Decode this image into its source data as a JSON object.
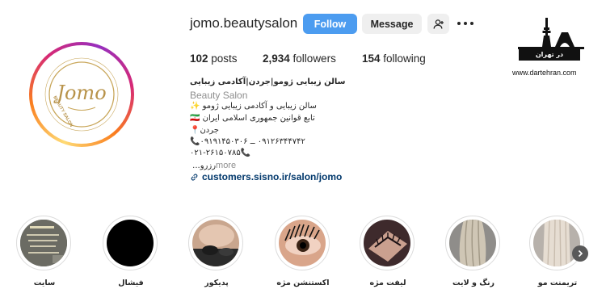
{
  "profile": {
    "username": "jomo.beautysalon",
    "avatar_logo_text": "Jomo",
    "avatar_sub_text": "BEAUTY SALON"
  },
  "actions": {
    "follow_label": "Follow",
    "message_label": "Message",
    "suggest_icon": "add-person-icon",
    "more_icon": "more-options-icon"
  },
  "stats": {
    "posts_count": "102",
    "posts_label": " posts",
    "followers_count": "2,934",
    "followers_label": " followers",
    "following_count": "154",
    "following_label": " following"
  },
  "bio": {
    "name": "سالن زیبایی ژومو|جردن|آکادمی زیبایی",
    "category": "Beauty Salon",
    "lines": [
      "سالن زیبایی و آکادمی زیبایی ژومو ✨",
      "تابع قوانین جمهوری اسلامی ایران 🇮🇷",
      "جردن📍",
      "۰۹۱۲۶۳۴۴۷۴۲ ــ ۰۹۱۹۱۴۵۰۳۰۶📞",
      "۰۲۱-۲۶۱۵۰۷۸۵📞"
    ],
    "more_prefix": "رزرو... ",
    "more_label": "more",
    "link": "customers.sisno.ir/salon/jomo"
  },
  "watermark": {
    "banner": "در تهران",
    "url": "www.dartehran.com"
  },
  "highlights": [
    {
      "label": "سایت",
      "icon": "website-highlight"
    },
    {
      "label": "فیشال",
      "icon": "facial-highlight"
    },
    {
      "label": "پدیکور",
      "icon": "pedicure-highlight"
    },
    {
      "label": "اکستنشن مژه",
      "icon": "eyelash-extension-highlight"
    },
    {
      "label": "لیفت مژه",
      "icon": "lash-lift-highlight"
    },
    {
      "label": "رنگ و لایت",
      "icon": "hair-color-highlight"
    },
    {
      "label": "تریمنت مو",
      "icon": "hair-treatment-highlight"
    }
  ],
  "colors": {
    "follow_bg": "#4c9cf0",
    "link": "#00376b",
    "muted": "#8e8e8e"
  }
}
